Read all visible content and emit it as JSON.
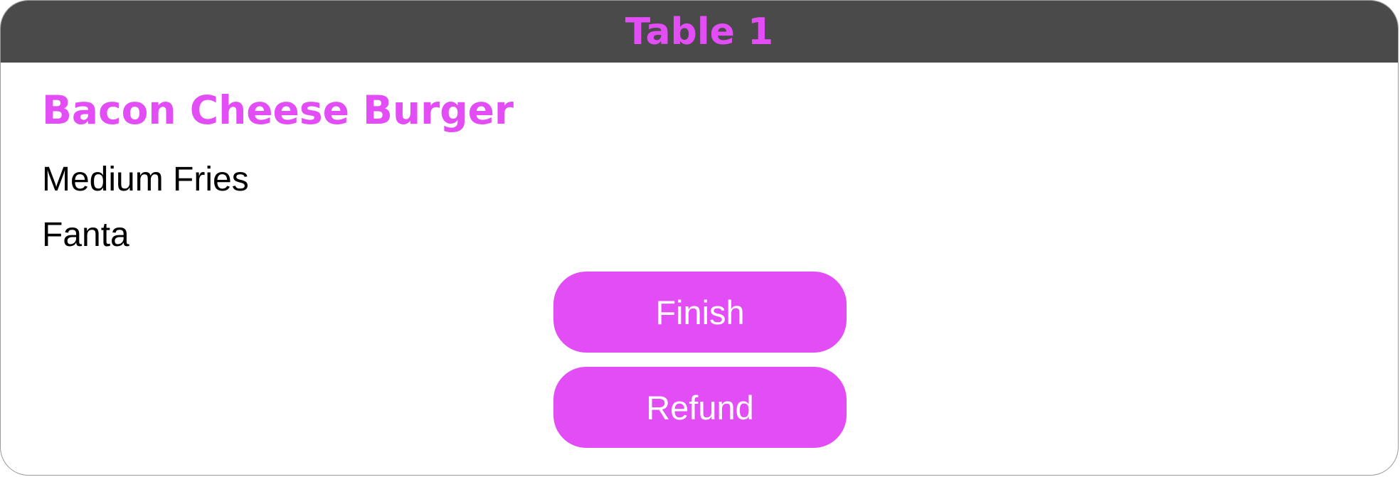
{
  "order_card": {
    "title": "Table 1",
    "main_item": "Bacon Cheese Burger",
    "side_items": [
      "Medium Fries",
      "Fanta"
    ],
    "actions": {
      "finish_label": "Finish",
      "refund_label": "Refund"
    }
  },
  "colors": {
    "accent": "#e24df5",
    "header_background": "#4a4a4a",
    "card_background": "#ffffff",
    "text": "#000000"
  }
}
